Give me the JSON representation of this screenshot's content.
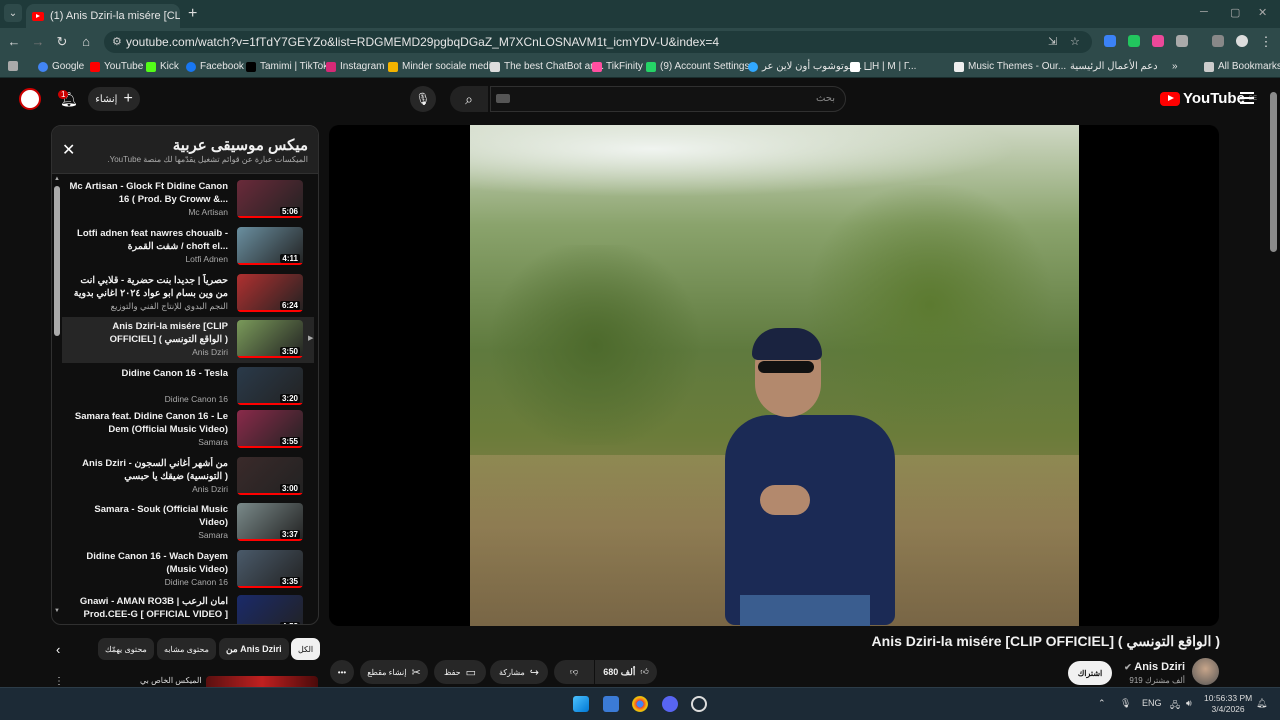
{
  "browser": {
    "tab_title": "(1) Anis Dziri-la misére [CLI",
    "url": "youtube.com/watch?v=1fTdY7GEYZo&list=RDGMEMD29pgbqDGaZ_M7XCnLOSNAVM1t_icmYDV-U&index=4",
    "bookmarks": [
      "Google",
      "YouTube",
      "Kick",
      "Facebook",
      "Tamimi | TikTok",
      "Instagram",
      "Minder sociale medi...",
      "The best ChatBot an...",
      "TikFinity",
      "(9) Account Settings...",
      "فوتوشوب أون لاين عر...",
      "⨆Н | М | Г...",
      "Music Themes - Our...",
      "دعم الأعمال الرئيسية"
    ],
    "all_bookmarks": "All Bookmarks"
  },
  "youtube": {
    "notif_count": "1",
    "create_label": "إنشاء",
    "search_placeholder": "بحث",
    "logo_text": "YouTube",
    "logo_region": "BE"
  },
  "playlist": {
    "title": "ميكس موسيقى عربية",
    "subtitle": "الميكسات عبارة عن قوائم تشغيل يقدّمها لك منصة YouTube.",
    "items": [
      {
        "title": "Mc Artisan - Glock Ft Didine Canon 16 ( Prod. By Croww &...",
        "channel": "Mc Artisan",
        "duration": "5:06",
        "color": "#6a2a3a",
        "active": false
      },
      {
        "title": "Lotfi adnen feat nawres chouaib - شفت القمرة / choft el...",
        "channel": "Lotfi Adnen",
        "duration": "4:11",
        "color": "#6a8fa0",
        "active": false
      },
      {
        "title": "حصرياً | جديدا بنت حضرية - قلابي انت من وين بسام ابو عواد ٢٠٢٤ اغاني بدوية",
        "channel": "النجم البدوي للإنتاج الفني والتوزيع",
        "duration": "6:24",
        "color": "#b03030",
        "active": false
      },
      {
        "title": "Anis Dziri-la misére [CLIP OFFICIEL] ( الواقع التونسي )",
        "channel": "Anis Dziri",
        "duration": "3:50",
        "color": "#7a9a5a",
        "active": true
      },
      {
        "title": "Didine Canon 16 - Tesla",
        "channel": "Didine Canon 16",
        "duration": "3:20",
        "color": "#2a3a4a",
        "active": false
      },
      {
        "title": "Samara feat. Didine Canon 16 - Le Dem (Official Music Video)",
        "channel": "Samara",
        "duration": "3:55",
        "color": "#8a2a4a",
        "active": false
      },
      {
        "title": "Anis Dziri - من أشهر أغاني السجون التونسية) ضيقك يا حبسي )",
        "channel": "Anis Dziri",
        "duration": "3:00",
        "color": "#3a2a2a",
        "active": false
      },
      {
        "title": "Samara - Souk (Official Music Video)",
        "channel": "Samara",
        "duration": "3:37",
        "color": "#7a8a8a",
        "active": false
      },
      {
        "title": "Didine Canon 16 - Wach Dayem (Music Video)",
        "channel": "Didine Canon 16",
        "duration": "3:35",
        "color": "#4a5a6a",
        "active": false
      },
      {
        "title": "Gnawi - AMAN RO3B | امان الرعب Prod.CEE-G [ OFFICIAL VIDEO ]",
        "channel": "",
        "duration": "4:53",
        "color": "#1a2a6a",
        "active": false
      }
    ]
  },
  "video": {
    "title": "Anis Dziri-la misére [CLIP OFFICIEL] ( الواقع التونسي )",
    "channel": "Anis Dziri",
    "subscribers": "919 ألف مشترك",
    "subscribe_label": "اشتراك",
    "likes": "680 ألف",
    "share_label": "مشاركة",
    "save_label": "حفظ",
    "clip_label": "إنشاء مقطع"
  },
  "chips": [
    "الكل",
    "من Anis Dziri",
    "محتوى مشابه",
    "محتوى يهمّك"
  ],
  "next_item": {
    "title": "الميكس الخاص بي"
  },
  "taskbar": {
    "lang": "ENG",
    "time": "10:56:33 PM",
    "date": "3/4/2026"
  },
  "colors": {
    "accent_red": "#ff0000",
    "chrome_bg": "#2e4a4a",
    "yt_bg": "#0f0f0f"
  }
}
